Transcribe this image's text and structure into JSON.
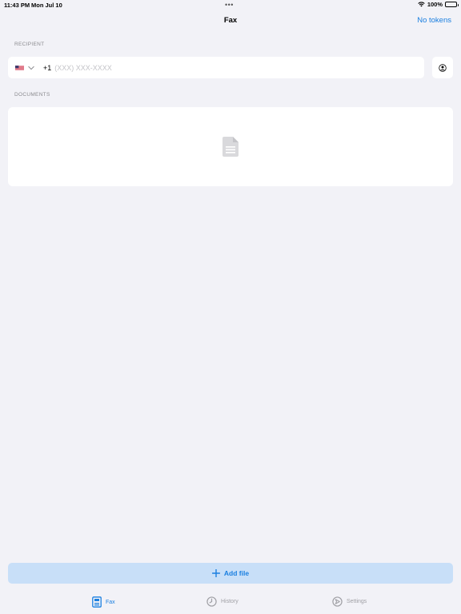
{
  "status_bar": {
    "time": "11:43 PM",
    "date": "Mon Jul 10",
    "dots": "•••",
    "battery": "100%"
  },
  "nav": {
    "title": "Fax",
    "action": "No tokens"
  },
  "recipient": {
    "label": "RECIPIENT",
    "country_code": "+1",
    "placeholder": "(XXX) XXX-XXXX",
    "value": ""
  },
  "documents": {
    "label": "DOCUMENTS"
  },
  "add_file": {
    "label": "Add file"
  },
  "tabs": [
    {
      "label": "Fax",
      "icon": "fax-icon",
      "active": true
    },
    {
      "label": "History",
      "icon": "clock-icon",
      "active": false
    },
    {
      "label": "Settings",
      "icon": "settings-icon",
      "active": false
    }
  ],
  "colors": {
    "accent": "#1a7fe0",
    "background": "#f2f2f7",
    "button_fill": "#c8dff8"
  }
}
